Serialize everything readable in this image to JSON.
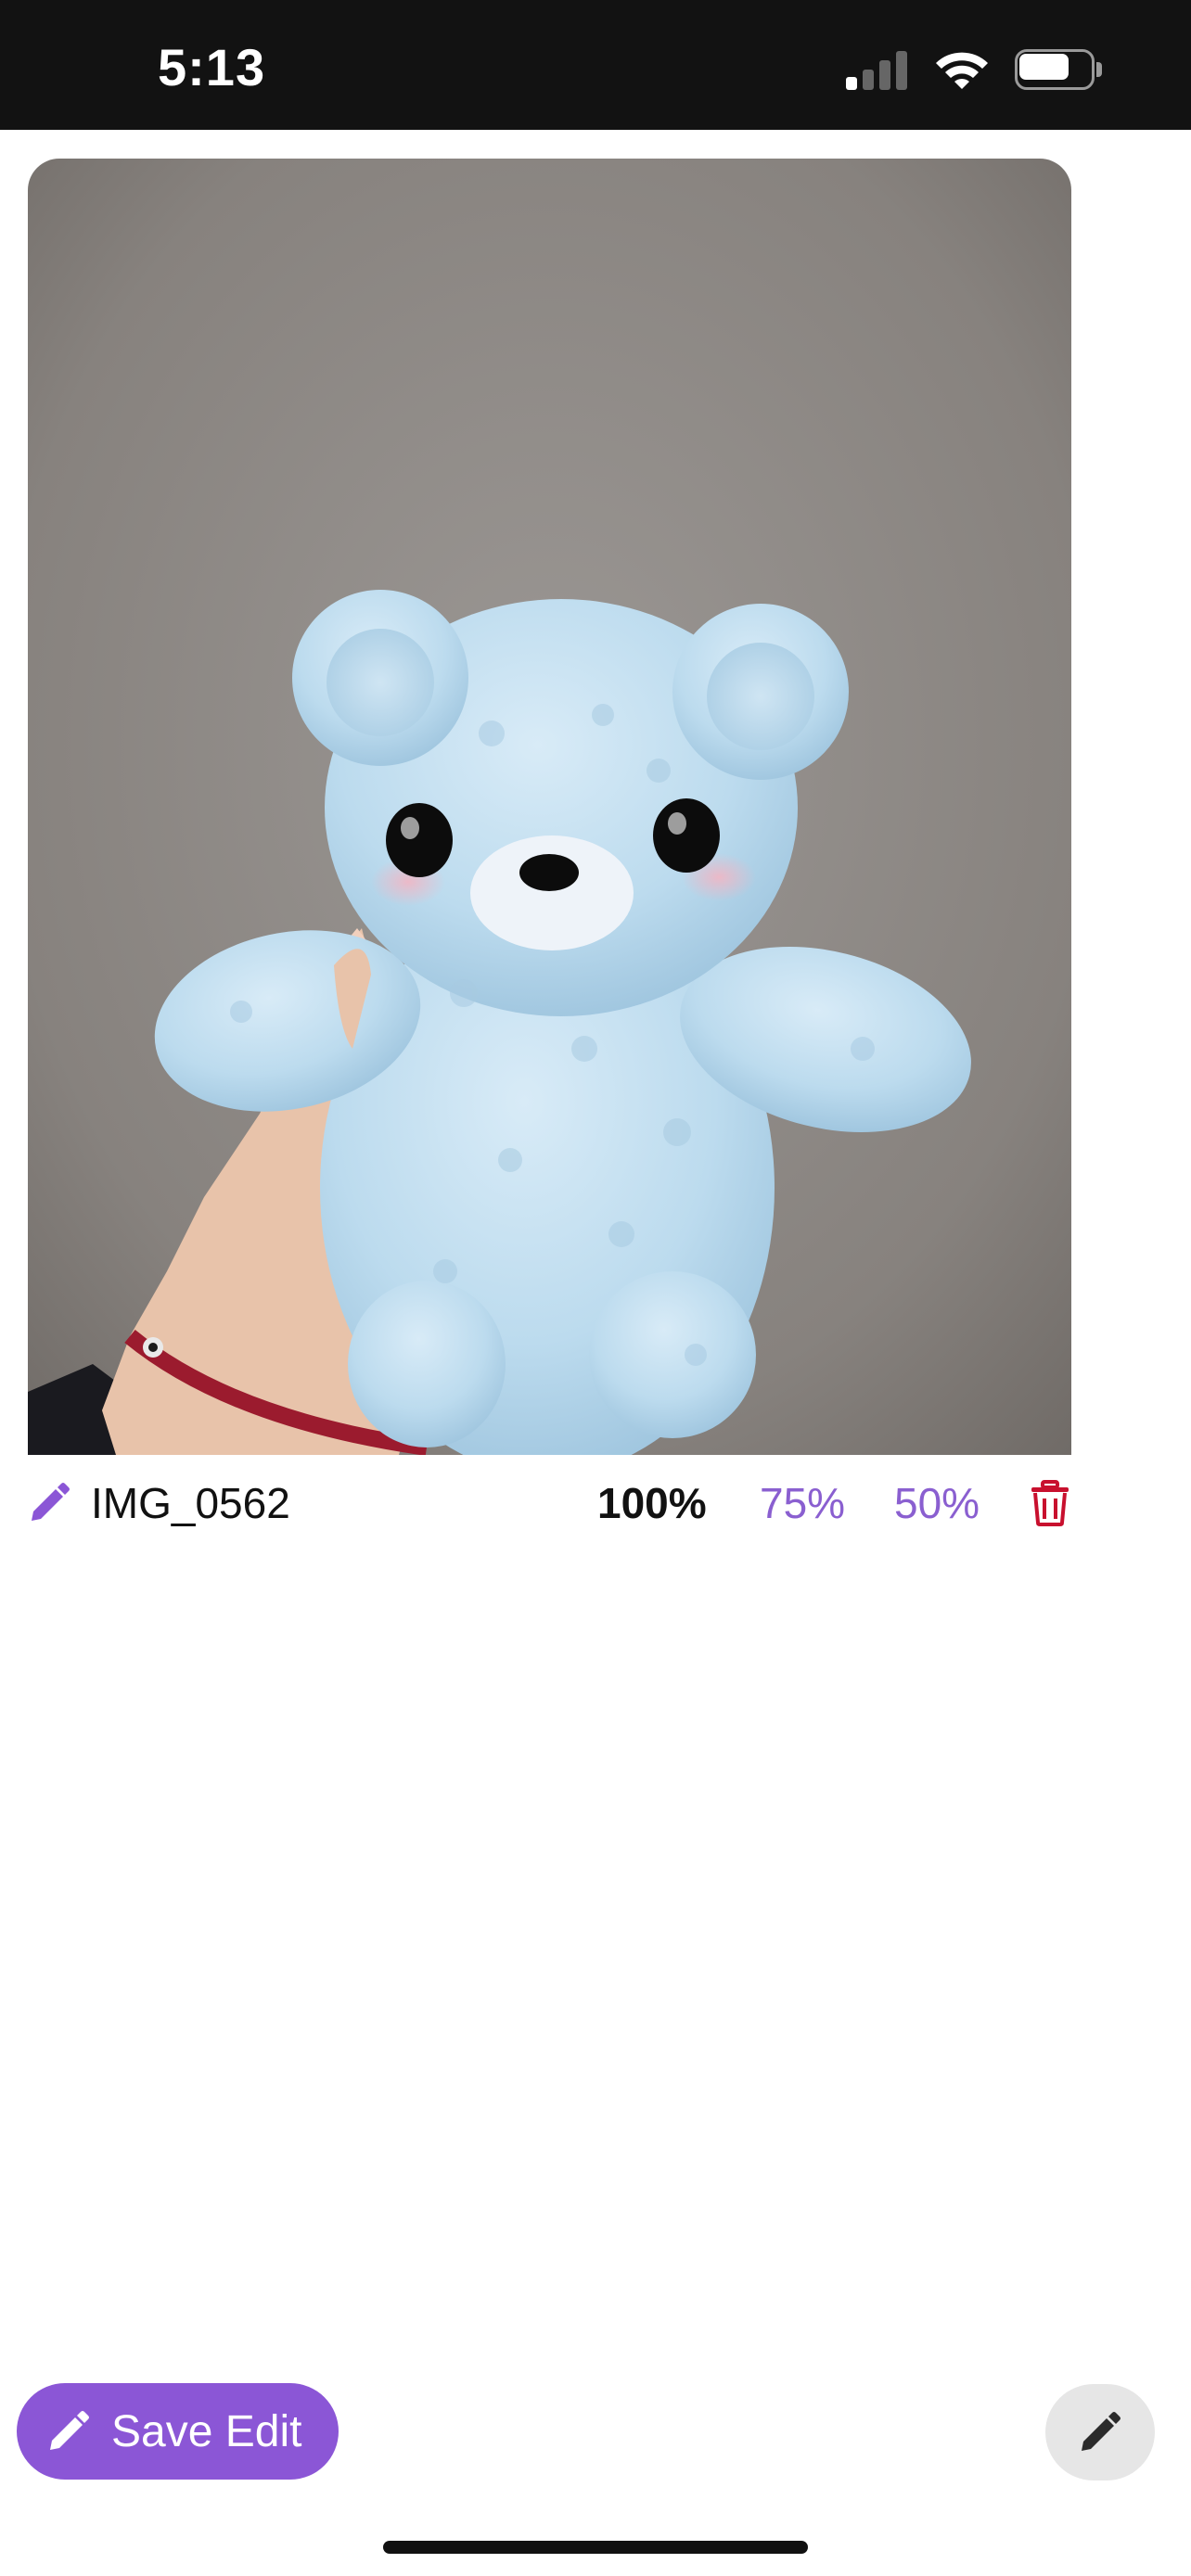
{
  "status_bar": {
    "time": "5:13",
    "signal_bars_active": 1,
    "signal_bars_total": 4,
    "battery_level": 0.7,
    "icons": [
      "signal-icon",
      "wifi-icon",
      "battery-icon"
    ]
  },
  "photo": {
    "subject": "light blue crocheted teddy bear held in a hand"
  },
  "caption": {
    "file_name": "IMG_0562",
    "scale_options": [
      "100%",
      "75%",
      "50%"
    ],
    "selected_scale": "100%",
    "rename_icon": "pencil-icon",
    "delete_icon": "trash-icon"
  },
  "actions": {
    "save_edit_label": "Save Edit",
    "save_edit_icon": "pencil-icon",
    "edit_fab_icon": "pencil-icon"
  },
  "colors": {
    "status_bar_bg": "#121212",
    "accent_purple": "#8b56d6",
    "delete_red": "#c8102e",
    "fab_grey": "#e6e6e6"
  }
}
